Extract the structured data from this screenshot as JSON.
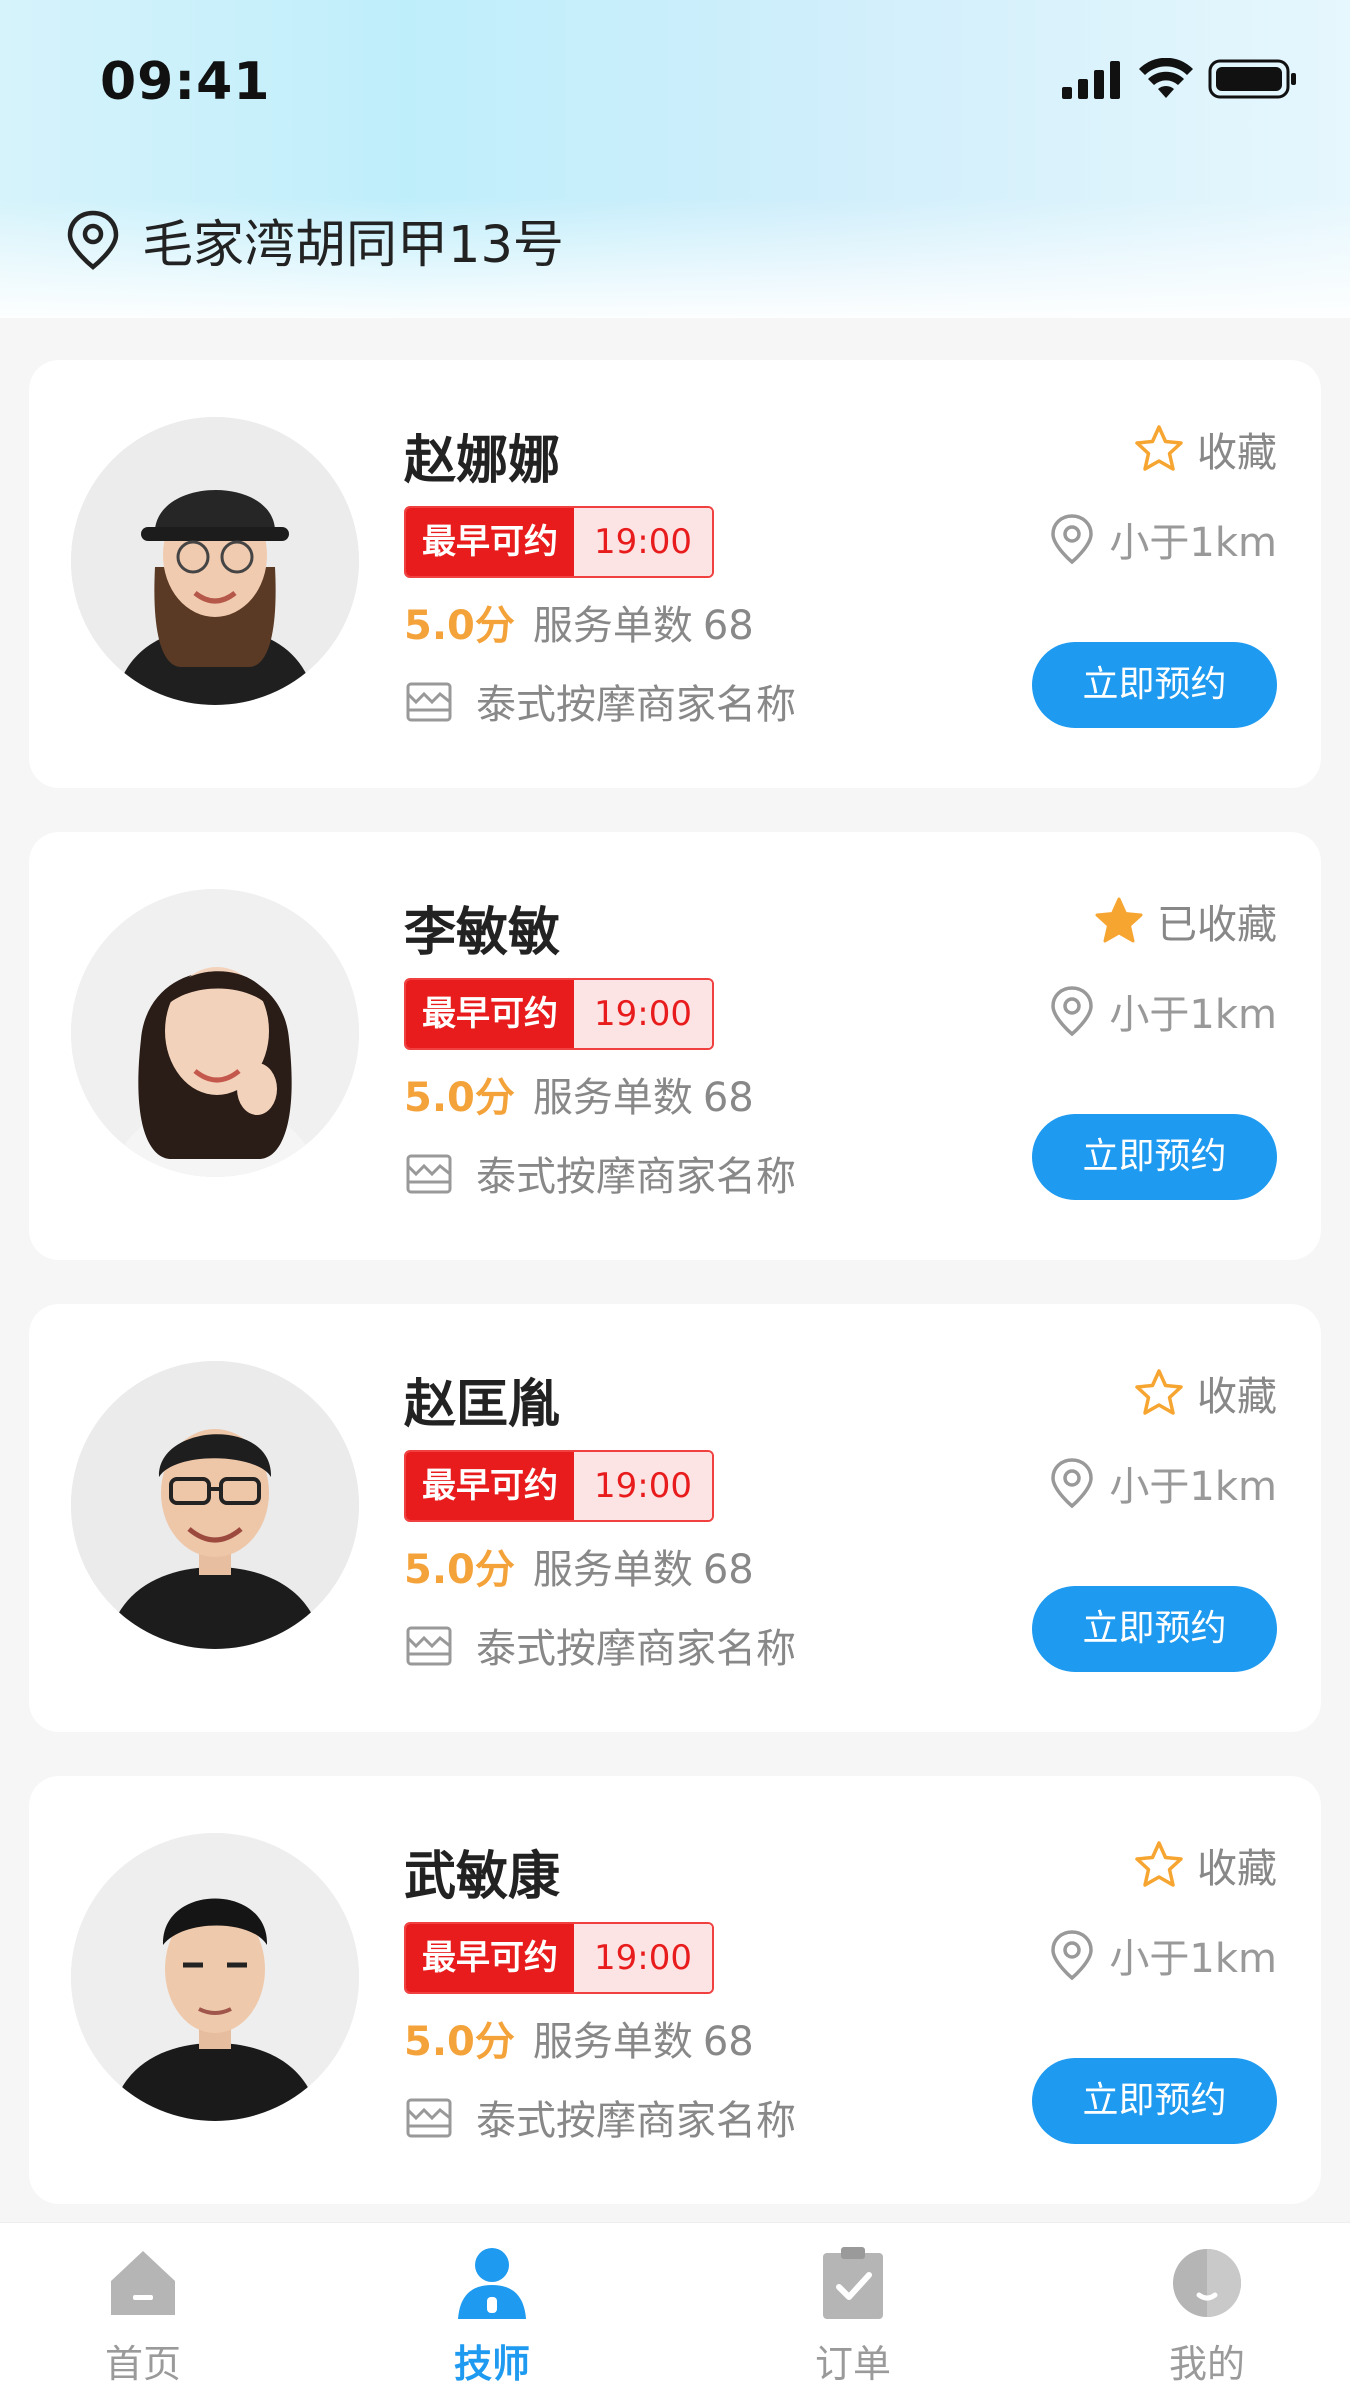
{
  "status_bar": {
    "time": "09:41"
  },
  "location": {
    "address": "毛家湾胡同甲13号"
  },
  "cards": [
    {
      "name": "赵娜娜",
      "tag_label": "最早可约",
      "tag_time": "19:00",
      "score": "5.0分",
      "orders_label": "服务单数",
      "orders_count": "68",
      "shop": "泰式按摩商家名称",
      "fav_label": "收藏",
      "favorited": false,
      "distance": "小于1km",
      "book_label": "立即预约"
    },
    {
      "name": "李敏敏",
      "tag_label": "最早可约",
      "tag_time": "19:00",
      "score": "5.0分",
      "orders_label": "服务单数",
      "orders_count": "68",
      "shop": "泰式按摩商家名称",
      "fav_label": "已收藏",
      "favorited": true,
      "distance": "小于1km",
      "book_label": "立即预约"
    },
    {
      "name": "赵匡胤",
      "tag_label": "最早可约",
      "tag_time": "19:00",
      "score": "5.0分",
      "orders_label": "服务单数",
      "orders_count": "68",
      "shop": "泰式按摩商家名称",
      "fav_label": "收藏",
      "favorited": false,
      "distance": "小于1km",
      "book_label": "立即预约"
    },
    {
      "name": "武敏康",
      "tag_label": "最早可约",
      "tag_time": "19:00",
      "score": "5.0分",
      "orders_label": "服务单数",
      "orders_count": "68",
      "shop": "泰式按摩商家名称",
      "fav_label": "收藏",
      "favorited": false,
      "distance": "小于1km",
      "book_label": "立即预约"
    }
  ],
  "tabbar": {
    "items": [
      {
        "label": "首页",
        "icon": "home-icon",
        "active": false
      },
      {
        "label": "技师",
        "icon": "technician-icon",
        "active": true
      },
      {
        "label": "订单",
        "icon": "order-icon",
        "active": false
      },
      {
        "label": "我的",
        "icon": "profile-icon",
        "active": false
      }
    ]
  },
  "colors": {
    "accent": "#1e9af0",
    "tag_red": "#e81c1c",
    "score_orange": "#f4a23a",
    "star_orange": "#f7a531"
  }
}
